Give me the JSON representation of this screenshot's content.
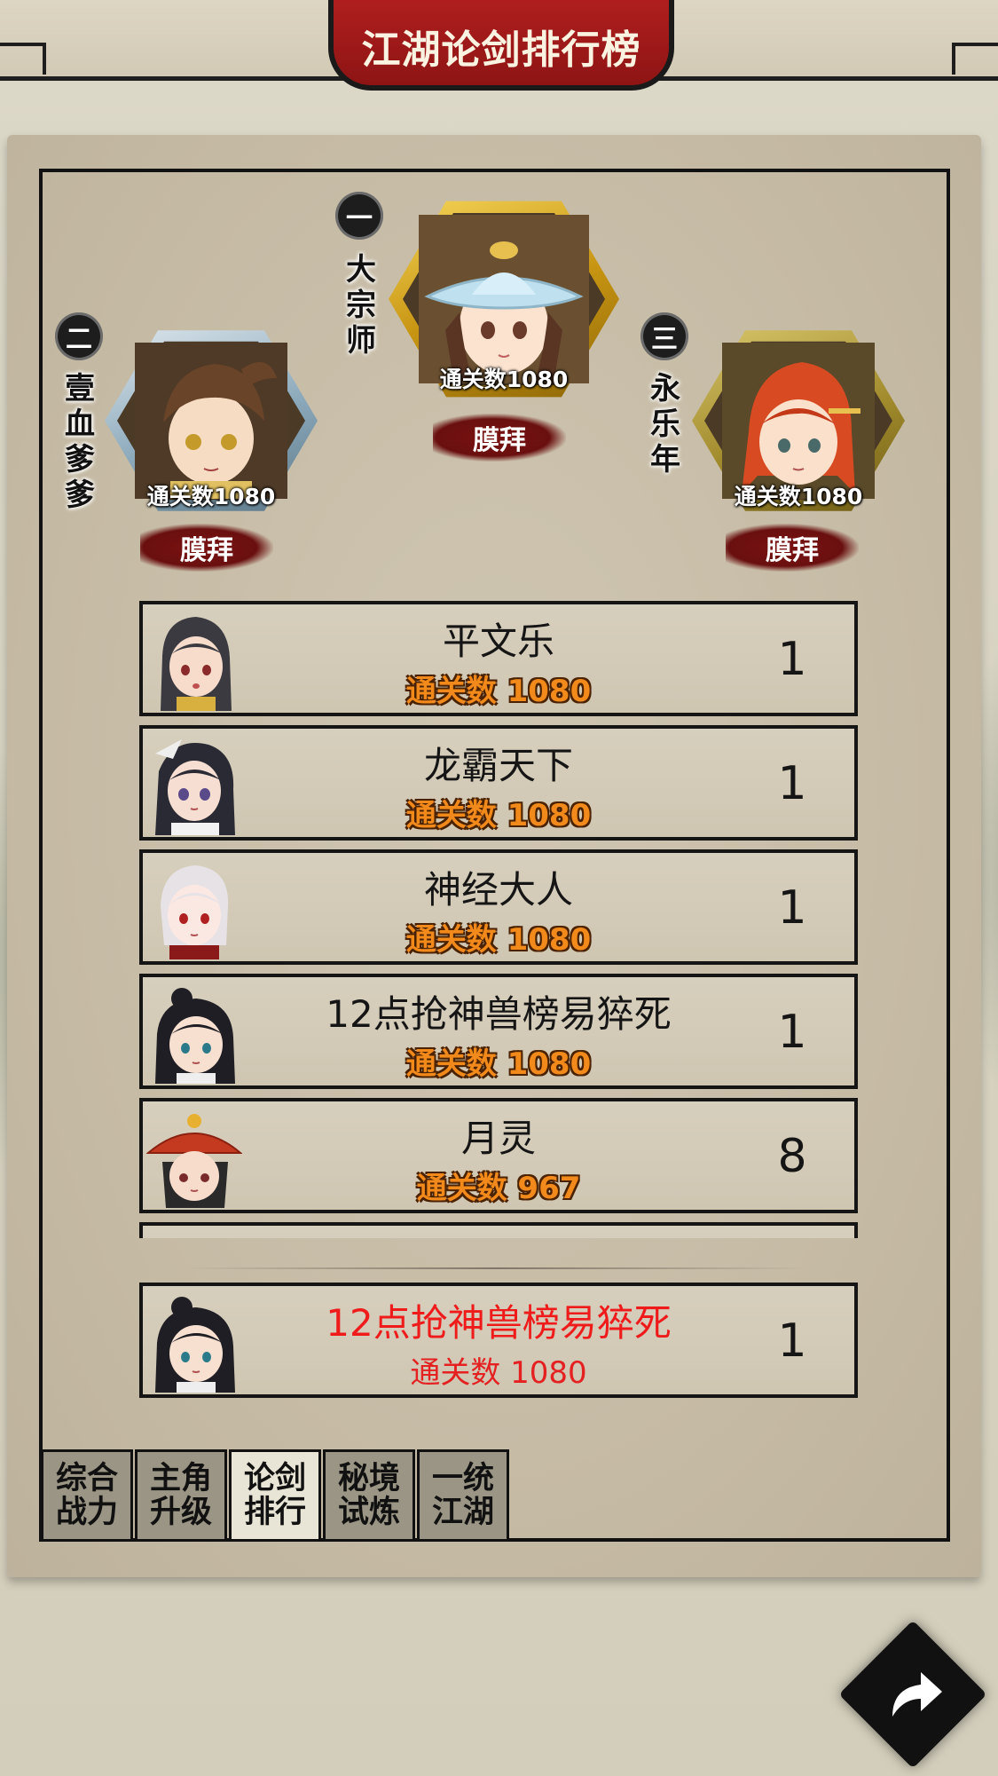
{
  "header": {
    "title": "江湖论剑排行榜"
  },
  "podium": {
    "first": {
      "rank_glyph": "一",
      "name": "大宗师",
      "name_chars": [
        "大",
        "宗",
        "师"
      ],
      "score": "通关数1080",
      "worship_label": "膜拜",
      "frame_color": "#d9a81a"
    },
    "second": {
      "rank_glyph": "二",
      "name": "壹血爹爹",
      "name_chars": [
        "壹",
        "血",
        "爹",
        "爹"
      ],
      "score": "通关数1080",
      "worship_label": "膜拜",
      "frame_color": "#8aa8ba"
    },
    "third": {
      "rank_glyph": "三",
      "name": "永乐年",
      "name_chars": [
        "永",
        "乐",
        "年"
      ],
      "score": "通关数1080",
      "worship_label": "膜拜",
      "frame_color": "#a08a2c"
    }
  },
  "ranking_list": [
    {
      "name": "平文乐",
      "score": "通关数 1080",
      "rank": "1"
    },
    {
      "name": "龙霸天下",
      "score": "通关数 1080",
      "rank": "1"
    },
    {
      "name": "神经大人",
      "score": "通关数 1080",
      "rank": "1"
    },
    {
      "name": "12点抢神兽榜易猝死",
      "score": "通关数 1080",
      "rank": "1"
    },
    {
      "name": "月灵",
      "score": "通关数 967",
      "rank": "8"
    },
    {
      "name": "",
      "score": "",
      "rank": ""
    }
  ],
  "my_rank": {
    "name": "12点抢神兽榜易猝死",
    "score": "通关数 1080",
    "rank": "1"
  },
  "tabs": [
    {
      "line1": "综合",
      "line2": "战力",
      "active": false
    },
    {
      "line1": "主角",
      "line2": "升级",
      "active": false
    },
    {
      "line1": "论剑",
      "line2": "排行",
      "active": true
    },
    {
      "line1": "秘境",
      "line2": "试炼",
      "active": false
    },
    {
      "line1": "一统",
      "line2": "江湖",
      "active": false
    }
  ],
  "icons": {
    "return": "return-arrow-icon"
  },
  "colors": {
    "title_banner": "#a51a1a",
    "score_orange": "#f28a1b",
    "my_rank_red": "#ef1b1b",
    "worship_red": "#6a0f0f"
  }
}
